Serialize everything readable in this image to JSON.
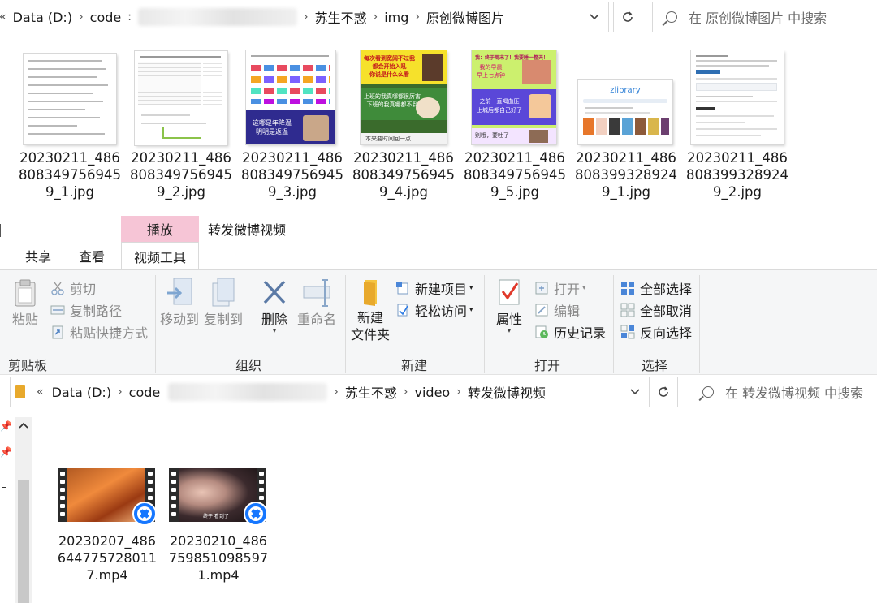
{
  "top_window": {
    "breadcrumb": {
      "prefix_chevron": "«",
      "drive": "Data (D:)",
      "code": "code",
      "folder_parent": "苏生不惑",
      "folder_img": "img",
      "current": "原创微博图片"
    },
    "search_placeholder": "在 原创微博图片 中搜索",
    "files": [
      {
        "line1": "20230211_486",
        "line2": "808349756945",
        "line3": "9_1.jpg"
      },
      {
        "line1": "20230211_486",
        "line2": "808349756945",
        "line3": "9_2.jpg"
      },
      {
        "line1": "20230211_486",
        "line2": "808349756945",
        "line3": "9_3.jpg"
      },
      {
        "line1": "20230211_486",
        "line2": "808349756945",
        "line3": "9_4.jpg"
      },
      {
        "line1": "20230211_486",
        "line2": "808349756945",
        "line3": "9_5.jpg"
      },
      {
        "line1": "20230211_486",
        "line2": "808399328924",
        "line3": "9_1.jpg"
      },
      {
        "line1": "20230211_486",
        "line2": "808399328924",
        "line3": "9_2.jpg"
      }
    ],
    "thumb_text": {
      "t3_caption_a": "这哪是年降温",
      "t3_caption_b": "明明是返温",
      "t4_banner_a": "每次看到宽阔不过我",
      "t4_banner_b": "都会开始入吼",
      "t4_banner_c": "你说是什么么看",
      "t4_mid_a": "上班的我真哪都很厉害",
      "t4_mid_b": "下班的我真哪都不到",
      "t4_bottom": "本来要时间回一点",
      "t5_top": "我：终于周末了！我要睡一整天！",
      "t5_top_b": "我的早晨",
      "t5_top_c": "早上七点钟",
      "t5_mid_a": "之前一直喝血压",
      "t5_mid_b": "上城后都自己好了",
      "t5_bottom": "别哦，要吐了",
      "t6_logo": "zlibrary"
    }
  },
  "bottom_window": {
    "context_tab": "播放",
    "title": "转发微博视频",
    "tabs": {
      "share": "共享",
      "view": "查看",
      "video_tools": "视频工具"
    },
    "ribbon": {
      "clipboard": {
        "paste": "粘贴",
        "cut": "剪切",
        "copy_path": "复制路径",
        "paste_shortcut": "粘贴快捷方式",
        "label": "剪贴板"
      },
      "organize": {
        "move_to": "移动到",
        "copy_to": "复制到",
        "delete": "删除",
        "rename": "重命名",
        "label": "组织"
      },
      "new": {
        "new_folder_a": "新建",
        "new_folder_b": "文件夹",
        "new_item": "新建项目",
        "easy_access": "轻松访问",
        "label": "新建"
      },
      "open": {
        "properties": "属性",
        "open": "打开",
        "edit": "编辑",
        "history": "历史记录",
        "label": "打开"
      },
      "select": {
        "select_all": "全部选择",
        "select_none": "全部取消",
        "invert": "反向选择",
        "label": "选择"
      }
    },
    "breadcrumb": {
      "prefix_chevron": "«",
      "drive": "Data (D:)",
      "code": "code",
      "folder_parent": "苏生不惑",
      "folder_video": "video",
      "current": "转发微博视频"
    },
    "search_placeholder": "在 转发微博视频 中搜索",
    "videos": [
      {
        "line1": "20230207_486",
        "line2": "644775728011",
        "line3": "7.mp4"
      },
      {
        "line1": "20230210_486",
        "line2": "759851098597",
        "line3": "1.mp4"
      }
    ],
    "video_caption": "终于 看到了"
  },
  "colors": {
    "context_tab": "#f6c5d6",
    "qq_badge": "#1677ff",
    "ribbon_bg": "#f5f6f7"
  }
}
